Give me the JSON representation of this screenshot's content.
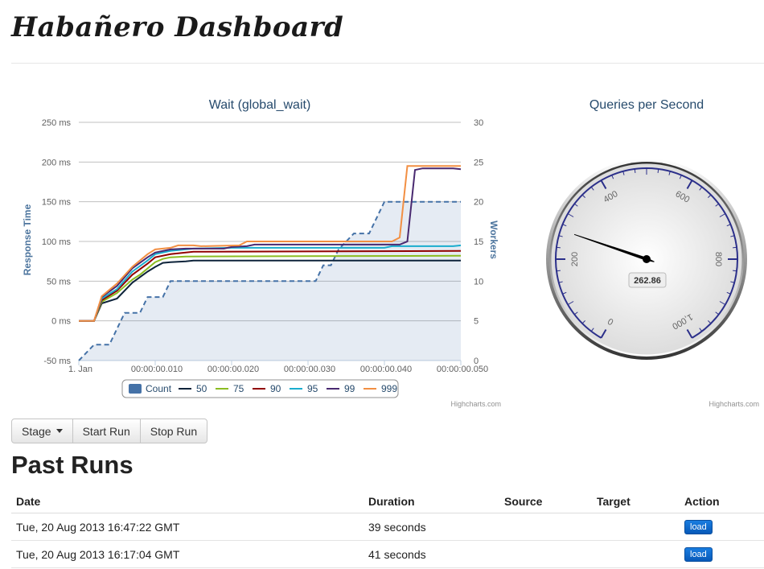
{
  "header": {
    "title": "Habañero Dashboard"
  },
  "wait_chart": {
    "title": "Wait (global_wait)",
    "left_axis_label": "Response Time",
    "right_axis_label": "Workers",
    "credit": "Highcharts.com"
  },
  "gauge": {
    "title": "Queries per Second",
    "credit": "Highcharts.com",
    "value_label": "262.86"
  },
  "toolbar": {
    "stage_label": "Stage",
    "start_label": "Start Run",
    "stop_label": "Stop Run"
  },
  "past_runs": {
    "title": "Past Runs",
    "columns": {
      "date": "Date",
      "duration": "Duration",
      "source": "Source",
      "target": "Target",
      "action": "Action"
    },
    "rows": [
      {
        "date": "Tue, 20 Aug 2013 16:47:22 GMT",
        "duration": "39 seconds",
        "source": "",
        "target": "",
        "action": "load"
      },
      {
        "date": "Tue, 20 Aug 2013 16:17:04 GMT",
        "duration": "41 seconds",
        "source": "",
        "target": "",
        "action": "load"
      }
    ]
  },
  "chart_data": [
    {
      "type": "line",
      "title": "Wait (global_wait)",
      "ylabel": "Response Time",
      "y2label": "Workers",
      "ylim": [
        -50,
        250
      ],
      "y_ticks": [
        -50,
        0,
        50,
        100,
        150,
        200,
        250
      ],
      "y_tick_labels": [
        "-50 ms",
        "0 ms",
        "50 ms",
        "100 ms",
        "150 ms",
        "200 ms",
        "250 ms"
      ],
      "y2lim": [
        0,
        30
      ],
      "y2_ticks": [
        0,
        5,
        10,
        15,
        20,
        25,
        30
      ],
      "x_ticks": [
        0,
        10,
        20,
        30,
        40,
        50
      ],
      "x_tick_labels": [
        "1. Jan",
        "00:00:00.010",
        "00:00:00.020",
        "00:00:00.030",
        "00:00:00.040",
        "00:00:00.050"
      ],
      "grid": true,
      "legend_position": "bottom",
      "count_area": {
        "name": "Count",
        "color": "#4572a7",
        "points": [
          [
            0,
            0
          ],
          [
            2,
            2
          ],
          [
            4,
            2
          ],
          [
            5,
            4
          ],
          [
            6,
            6
          ],
          [
            8,
            6
          ],
          [
            9,
            8
          ],
          [
            11,
            8
          ],
          [
            12,
            10
          ],
          [
            31,
            10
          ],
          [
            32,
            12
          ],
          [
            33,
            12
          ],
          [
            34,
            14
          ],
          [
            36,
            16
          ],
          [
            38,
            16
          ],
          [
            39,
            18
          ],
          [
            40,
            20
          ],
          [
            50,
            20
          ]
        ]
      },
      "series": [
        {
          "name": "50",
          "color": "#0d233a",
          "points": [
            [
              0,
              0
            ],
            [
              2,
              0
            ],
            [
              3,
              22
            ],
            [
              5,
              28
            ],
            [
              7,
              48
            ],
            [
              9,
              62
            ],
            [
              10,
              68
            ],
            [
              11,
              73
            ],
            [
              12,
              74
            ],
            [
              14,
              75
            ],
            [
              15,
              76
            ],
            [
              50,
              76
            ]
          ]
        },
        {
          "name": "75",
          "color": "#8bbc21",
          "points": [
            [
              0,
              0
            ],
            [
              2,
              0
            ],
            [
              3,
              24
            ],
            [
              5,
              35
            ],
            [
              7,
              52
            ],
            [
              8,
              58
            ],
            [
              10,
              74
            ],
            [
              11,
              78
            ],
            [
              12,
              80
            ],
            [
              14,
              81
            ],
            [
              50,
              82
            ]
          ]
        },
        {
          "name": "90",
          "color": "#910000",
          "points": [
            [
              0,
              0
            ],
            [
              2,
              0
            ],
            [
              3,
              26
            ],
            [
              5,
              38
            ],
            [
              7,
              58
            ],
            [
              9,
              72
            ],
            [
              10,
              80
            ],
            [
              12,
              84
            ],
            [
              14,
              86
            ],
            [
              15,
              87
            ],
            [
              50,
              88
            ]
          ]
        },
        {
          "name": "95",
          "color": "#1aadce",
          "points": [
            [
              0,
              0
            ],
            [
              2,
              0
            ],
            [
              3,
              28
            ],
            [
              5,
              40
            ],
            [
              7,
              62
            ],
            [
              9,
              76
            ],
            [
              10,
              84
            ],
            [
              12,
              88
            ],
            [
              15,
              91
            ],
            [
              20,
              92
            ],
            [
              40,
              92
            ],
            [
              41,
              94
            ],
            [
              49,
              94
            ],
            [
              50,
              95
            ]
          ]
        },
        {
          "name": "99",
          "color": "#492970",
          "points": [
            [
              0,
              0
            ],
            [
              2,
              0
            ],
            [
              3,
              30
            ],
            [
              5,
              44
            ],
            [
              7,
              66
            ],
            [
              9,
              80
            ],
            [
              10,
              86
            ],
            [
              12,
              90
            ],
            [
              14,
              91
            ],
            [
              19,
              91
            ],
            [
              20,
              93
            ],
            [
              22,
              94
            ],
            [
              23,
              96
            ],
            [
              42,
              96
            ],
            [
              43,
              100
            ],
            [
              44,
              190
            ],
            [
              45,
              192
            ],
            [
              49,
              192
            ],
            [
              50,
              191
            ]
          ]
        },
        {
          "name": "999",
          "color": "#f28f43",
          "points": [
            [
              0,
              0
            ],
            [
              2,
              0
            ],
            [
              3,
              31
            ],
            [
              5,
              47
            ],
            [
              7,
              68
            ],
            [
              9,
              84
            ],
            [
              10,
              90
            ],
            [
              12,
              92
            ],
            [
              13,
              95
            ],
            [
              15,
              95
            ],
            [
              16,
              94
            ],
            [
              21,
              95
            ],
            [
              22,
              100
            ],
            [
              41,
              100
            ],
            [
              42,
              105
            ],
            [
              43,
              195
            ],
            [
              50,
              195
            ]
          ]
        }
      ]
    },
    {
      "type": "gauge",
      "title": "Queries per Second",
      "value": 262.86,
      "range": [
        0,
        1000
      ],
      "tick_labels": [
        "0",
        "200",
        "400",
        "600",
        "800",
        "1,000"
      ]
    }
  ]
}
